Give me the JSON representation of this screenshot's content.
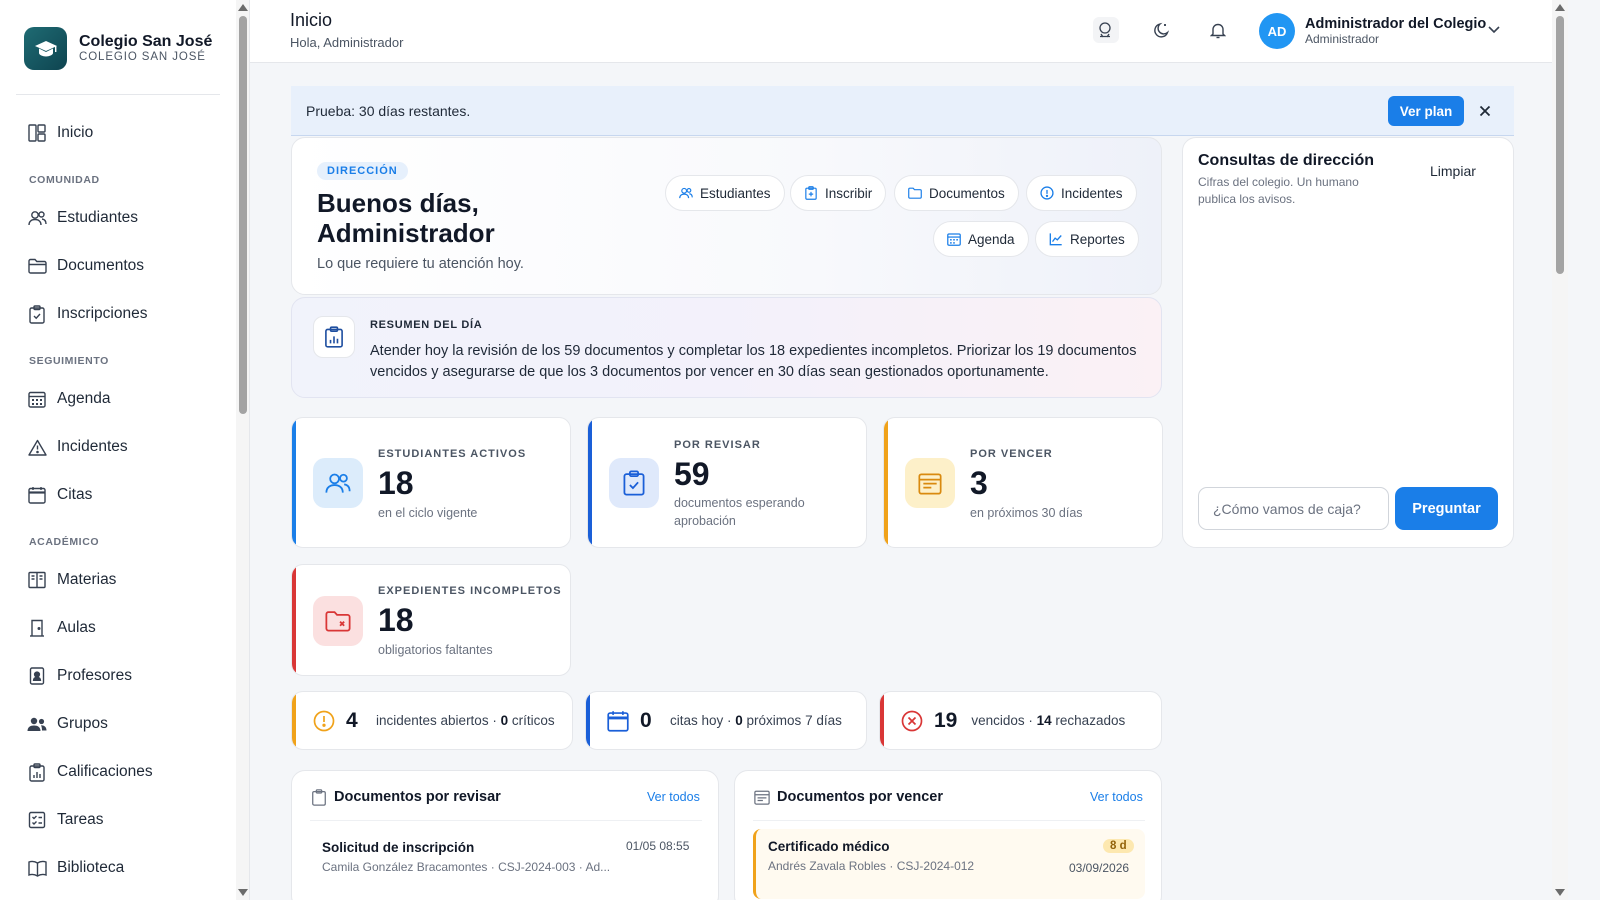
{
  "sidebar": {
    "school_name": "Colegio San José",
    "school_sub": "COLEGIO SAN JOSÉ",
    "items": [
      {
        "label": "Inicio",
        "icon": "dashboard-icon"
      },
      {
        "label": "Estudiantes",
        "icon": "users-icon"
      },
      {
        "label": "Documentos",
        "icon": "folder-icon"
      },
      {
        "label": "Inscripciones",
        "icon": "clipboard-icon"
      },
      {
        "label": "Agenda",
        "icon": "calendar-grid-icon"
      },
      {
        "label": "Incidentes",
        "icon": "warning-icon"
      },
      {
        "label": "Citas",
        "icon": "calendar-icon"
      },
      {
        "label": "Materias",
        "icon": "book-open-icon"
      },
      {
        "label": "Aulas",
        "icon": "door-icon"
      },
      {
        "label": "Profesores",
        "icon": "id-badge-icon"
      },
      {
        "label": "Grupos",
        "icon": "group-icon"
      },
      {
        "label": "Calificaciones",
        "icon": "chart-clipboard-icon"
      },
      {
        "label": "Tareas",
        "icon": "task-icon"
      },
      {
        "label": "Biblioteca",
        "icon": "library-icon"
      }
    ],
    "sections": {
      "comunidad": "COMUNIDAD",
      "seguimiento": "SEGUIMIENTO",
      "academico": "ACADÉMICO"
    }
  },
  "header": {
    "title": "Inicio",
    "subtitle": "Hola, Administrador",
    "user_initials": "AD",
    "user_name": "Administrador del Colegio",
    "user_role": "Administrador"
  },
  "trial": {
    "text": "Prueba: 30 días restantes.",
    "button": "Ver plan"
  },
  "hero": {
    "badge": "DIRECCIÓN",
    "title": "Buenos días, Administrador",
    "subtitle": "Lo que requiere tu atención hoy.",
    "actions": [
      "Estudiantes",
      "Inscribir",
      "Documentos",
      "Incidentes",
      "Agenda",
      "Reportes"
    ]
  },
  "summary": {
    "heading": "RESUMEN DEL DÍA",
    "text": "Atender hoy la revisión de los 59 documentos y completar los 18 expedientes incompletos. Priorizar los 19 documentos vencidos y asegurarse de que los 3 documentos por vencer en 30 días sean gestionados oportunamente."
  },
  "stats": [
    {
      "label": "ESTUDIANTES ACTIVOS",
      "value": "18",
      "note": "en el ciclo vigente",
      "color": "#1a7ee8"
    },
    {
      "label": "POR REVISAR",
      "value": "59",
      "note": "documentos esperando aprobación",
      "color": "#1a5fd8"
    },
    {
      "label": "POR VENCER",
      "value": "3",
      "note": "en próximos 30 días",
      "color": "#f0a21a"
    },
    {
      "label": "EXPEDIENTES INCOMPLETOS",
      "value": "18",
      "note": "obligatorios faltantes",
      "color": "#d93636"
    }
  ],
  "mini": [
    {
      "value": "4",
      "text": "incidentes abiertos · ",
      "bold": "0",
      "text2": " críticos",
      "color": "#f0a21a"
    },
    {
      "value": "0",
      "text": "citas hoy · ",
      "bold": "0",
      "text2": " próximos 7 días",
      "color": "#1a5fd8"
    },
    {
      "value": "19",
      "text": "vencidos · ",
      "bold": "14",
      "text2": " rechazados",
      "color": "#d93636"
    }
  ],
  "review": {
    "title": "Documentos por revisar",
    "link": "Ver todos",
    "item_title": "Solicitud de inscripción",
    "item_sub": "Camila González Bracamontes · CSJ-2024-003 · Ad...",
    "item_date": "01/05 08:55"
  },
  "expiring": {
    "title": "Documentos por vencer",
    "link": "Ver todos",
    "item_title": "Certificado médico",
    "item_sub": "Andrés Zavala Robles · CSJ-2024-012",
    "item_days": "8 d",
    "item_date": "03/09/2026"
  },
  "consultas": {
    "title": "Consultas de dirección",
    "subtitle": "Cifras del colegio. Un humano publica los avisos.",
    "clear": "Limpiar",
    "placeholder": "¿Cómo vamos de caja?",
    "button": "Preguntar"
  }
}
